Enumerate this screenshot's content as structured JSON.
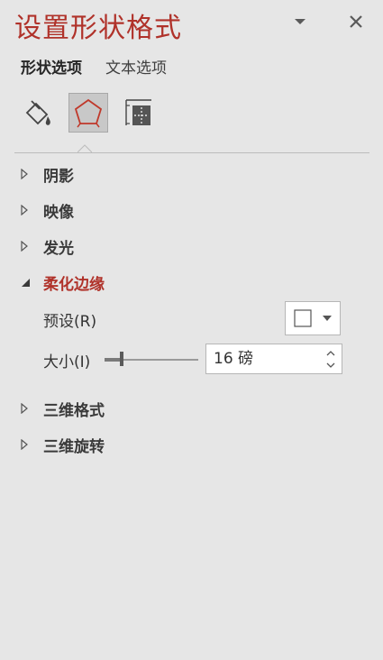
{
  "title": "设置形状格式",
  "tabs": [
    {
      "label": "形状选项",
      "active": true
    },
    {
      "label": "文本选项",
      "active": false
    }
  ],
  "icons": [
    "fill-line-icon",
    "effects-pentagon-icon",
    "size-properties-icon"
  ],
  "sections": [
    {
      "label": "阴影",
      "expanded": false
    },
    {
      "label": "映像",
      "expanded": false
    },
    {
      "label": "发光",
      "expanded": false
    },
    {
      "label": "柔化边缘",
      "expanded": true
    },
    {
      "label": "三维格式",
      "expanded": false
    },
    {
      "label": "三维旋转",
      "expanded": false
    }
  ],
  "soft_edges": {
    "preset_label": "预设(R)",
    "size_label": "大小(I)",
    "size_value": "16 磅",
    "slider_level": 0.03
  },
  "colors": {
    "accent": "#b0322a",
    "panel_bg": "#e6e6e6"
  }
}
